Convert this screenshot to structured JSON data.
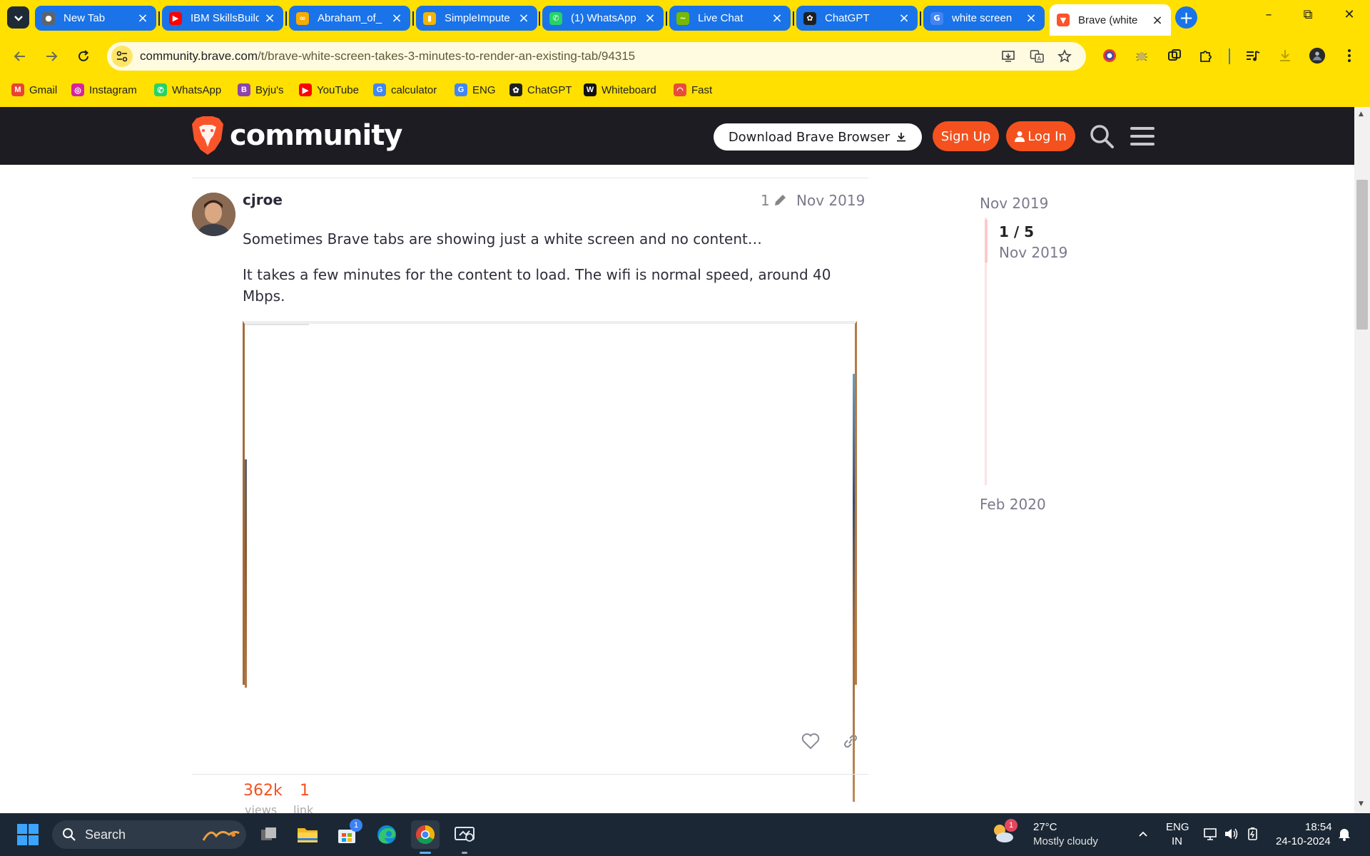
{
  "browser": {
    "tabs": [
      {
        "title": "New Tab",
        "favicon": "chrome-icon",
        "color": "#5f6368"
      },
      {
        "title": "IBM SkillsBuild",
        "favicon": "youtube-icon",
        "color": "#ff0000"
      },
      {
        "title": "Abraham_of_",
        "favicon": "colab-icon",
        "color": "#f9ab00"
      },
      {
        "title": "SimpleImpute",
        "favicon": "document-icon",
        "color": "#f4b400"
      },
      {
        "title": "(1) WhatsApp",
        "favicon": "whatsapp-icon",
        "color": "#25d366"
      },
      {
        "title": "Live Chat",
        "favicon": "livechat-icon",
        "color": "#76b900"
      },
      {
        "title": "ChatGPT",
        "favicon": "chatgpt-icon",
        "color": "#1f1f1f"
      },
      {
        "title": "white screen",
        "favicon": "google-icon",
        "color": "#4285f4"
      },
      {
        "title": "Brave (white",
        "favicon": "brave-icon",
        "color": "#fb542b",
        "active": true
      }
    ],
    "address": {
      "domain": "community.brave.com",
      "path": "/t/brave-white-screen-takes-3-minutes-to-render-an-existing-tab/94315"
    },
    "bookmarks": [
      {
        "label": "Gmail",
        "icon": "gmail-icon",
        "color": "#ea4335"
      },
      {
        "label": "Instagram",
        "icon": "instagram-icon",
        "color": "#d6249f"
      },
      {
        "label": "WhatsApp",
        "icon": "whatsapp-icon",
        "color": "#25d366"
      },
      {
        "label": "Byju's",
        "icon": "byjus-icon",
        "color": "#8e44ad"
      },
      {
        "label": "YouTube",
        "icon": "youtube-icon",
        "color": "#ff0000"
      },
      {
        "label": "calculator",
        "icon": "google-icon",
        "color": "#4285f4"
      },
      {
        "label": "ENG",
        "icon": "google-icon",
        "color": "#4285f4"
      },
      {
        "label": "ChatGPT",
        "icon": "chatgpt-icon",
        "color": "#1f1f1f"
      },
      {
        "label": "Whiteboard",
        "icon": "whiteboard-icon",
        "color": "#111111"
      },
      {
        "label": "Fast",
        "icon": "fast-icon",
        "color": "#e74c3c"
      }
    ],
    "chrome_color": "#ffe000"
  },
  "site": {
    "logo_text": "community",
    "download_label": "Download Brave Browser",
    "signup_label": "Sign Up",
    "login_label": "Log In",
    "accent": "#f4511e"
  },
  "post": {
    "username": "cjroe",
    "edit_count": "1",
    "date": "Nov 2019",
    "paragraph1": "Sometimes Brave tabs are showing just a white screen and no content…",
    "paragraph2": "It takes a few minutes for the content to load. The wifi is normal speed, around 40 Mbps.",
    "views_count": "362k",
    "views_label": "views",
    "links_count": "1",
    "links_label": "link"
  },
  "timeline": {
    "start": "Nov 2019",
    "position": "1 / 5",
    "position_date": "Nov 2019",
    "end": "Feb 2020"
  },
  "taskbar": {
    "search_placeholder": "Search",
    "weather_temp": "27°C",
    "weather_desc": "Mostly cloudy",
    "weather_badge": "1",
    "store_badge": "1",
    "lang_line1": "ENG",
    "lang_line2": "IN",
    "time": "18:54",
    "date": "24-10-2024"
  }
}
